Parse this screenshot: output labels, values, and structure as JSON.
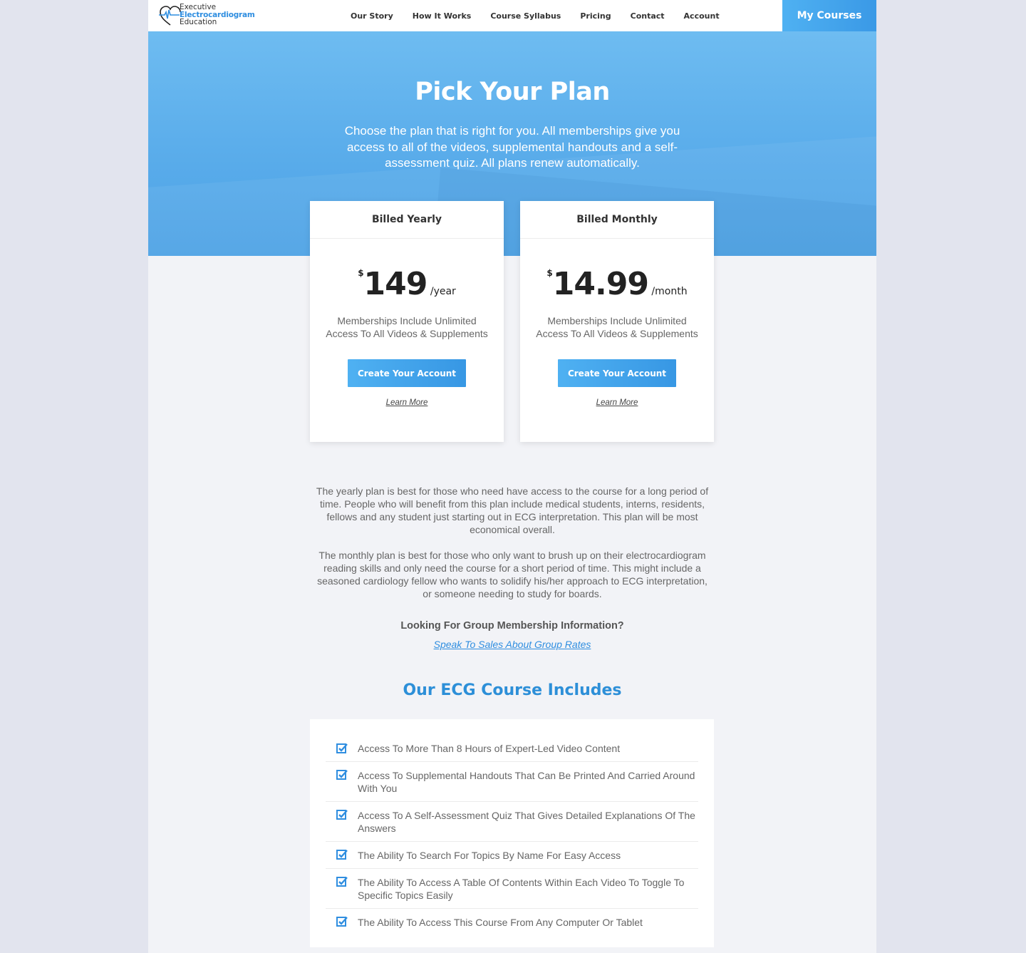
{
  "header": {
    "logo": {
      "line1": "Executive",
      "line2": "Electrocardiogram",
      "line3": "Education"
    },
    "nav": [
      "Our Story",
      "How It Works",
      "Course Syllabus",
      "Pricing",
      "Contact",
      "Account"
    ],
    "cta": "My Courses"
  },
  "hero": {
    "title": "Pick Your Plan",
    "subtitle": "Choose the plan that is right for you. All memberships give you access to all of the videos, supplemental handouts and a self-assessment quiz. All plans renew automatically."
  },
  "plans": [
    {
      "name": "Billed Yearly",
      "currency": "$",
      "amount": "149",
      "period": "/year",
      "description": "Memberships Include Unlimited Access To All Videos & Supplements",
      "button": "Create Your Account",
      "link": "Learn More"
    },
    {
      "name": "Billed Monthly",
      "currency": "$",
      "amount": "14.99",
      "period": "/month",
      "description": "Memberships Include Unlimited Access To All Videos & Supplements",
      "button": "Create Your Account",
      "link": "Learn More"
    }
  ],
  "copy": {
    "yearly": "The yearly plan is best for those who need have access to the course for a long period of time.  People who will benefit from this plan include medical students, interns, residents, fellows and any student just starting out in ECG interpretation. This plan will be most economical overall.",
    "monthly": "The monthly plan is best for those who only want to brush up on their electrocardiogram reading skills and only need the course for a short period of time.  This might include a seasoned cardiology fellow who wants to solidify his/her approach to ECG interpretation, or someone needing to study for boards."
  },
  "group": {
    "title": "Looking For Group Membership Information?",
    "link": "Speak To Sales About Group Rates"
  },
  "includes": {
    "title": "Our ECG Course Includes",
    "items": [
      "Access To More Than 8 Hours of Expert-Led Video Content",
      "Access To Supplemental Handouts That Can Be Printed And Carried Around With You",
      "Access To A Self-Assessment Quiz That Gives Detailed Explanations Of The Answers",
      "The Ability To Search For Topics By Name For Easy Access",
      "The Ability To Access A Table Of Contents Within Each Video To Toggle To Specific Topics Easily",
      "The Ability To Access This Course From Any Computer Or Tablet"
    ]
  },
  "colors": {
    "accent": "#3a99e6",
    "heading_blue": "#2d8fd8",
    "check": "#2f8ee0"
  },
  "icons": {
    "list_marker": "checkbox-checked-icon",
    "logo": "heart-ecg-icon"
  }
}
